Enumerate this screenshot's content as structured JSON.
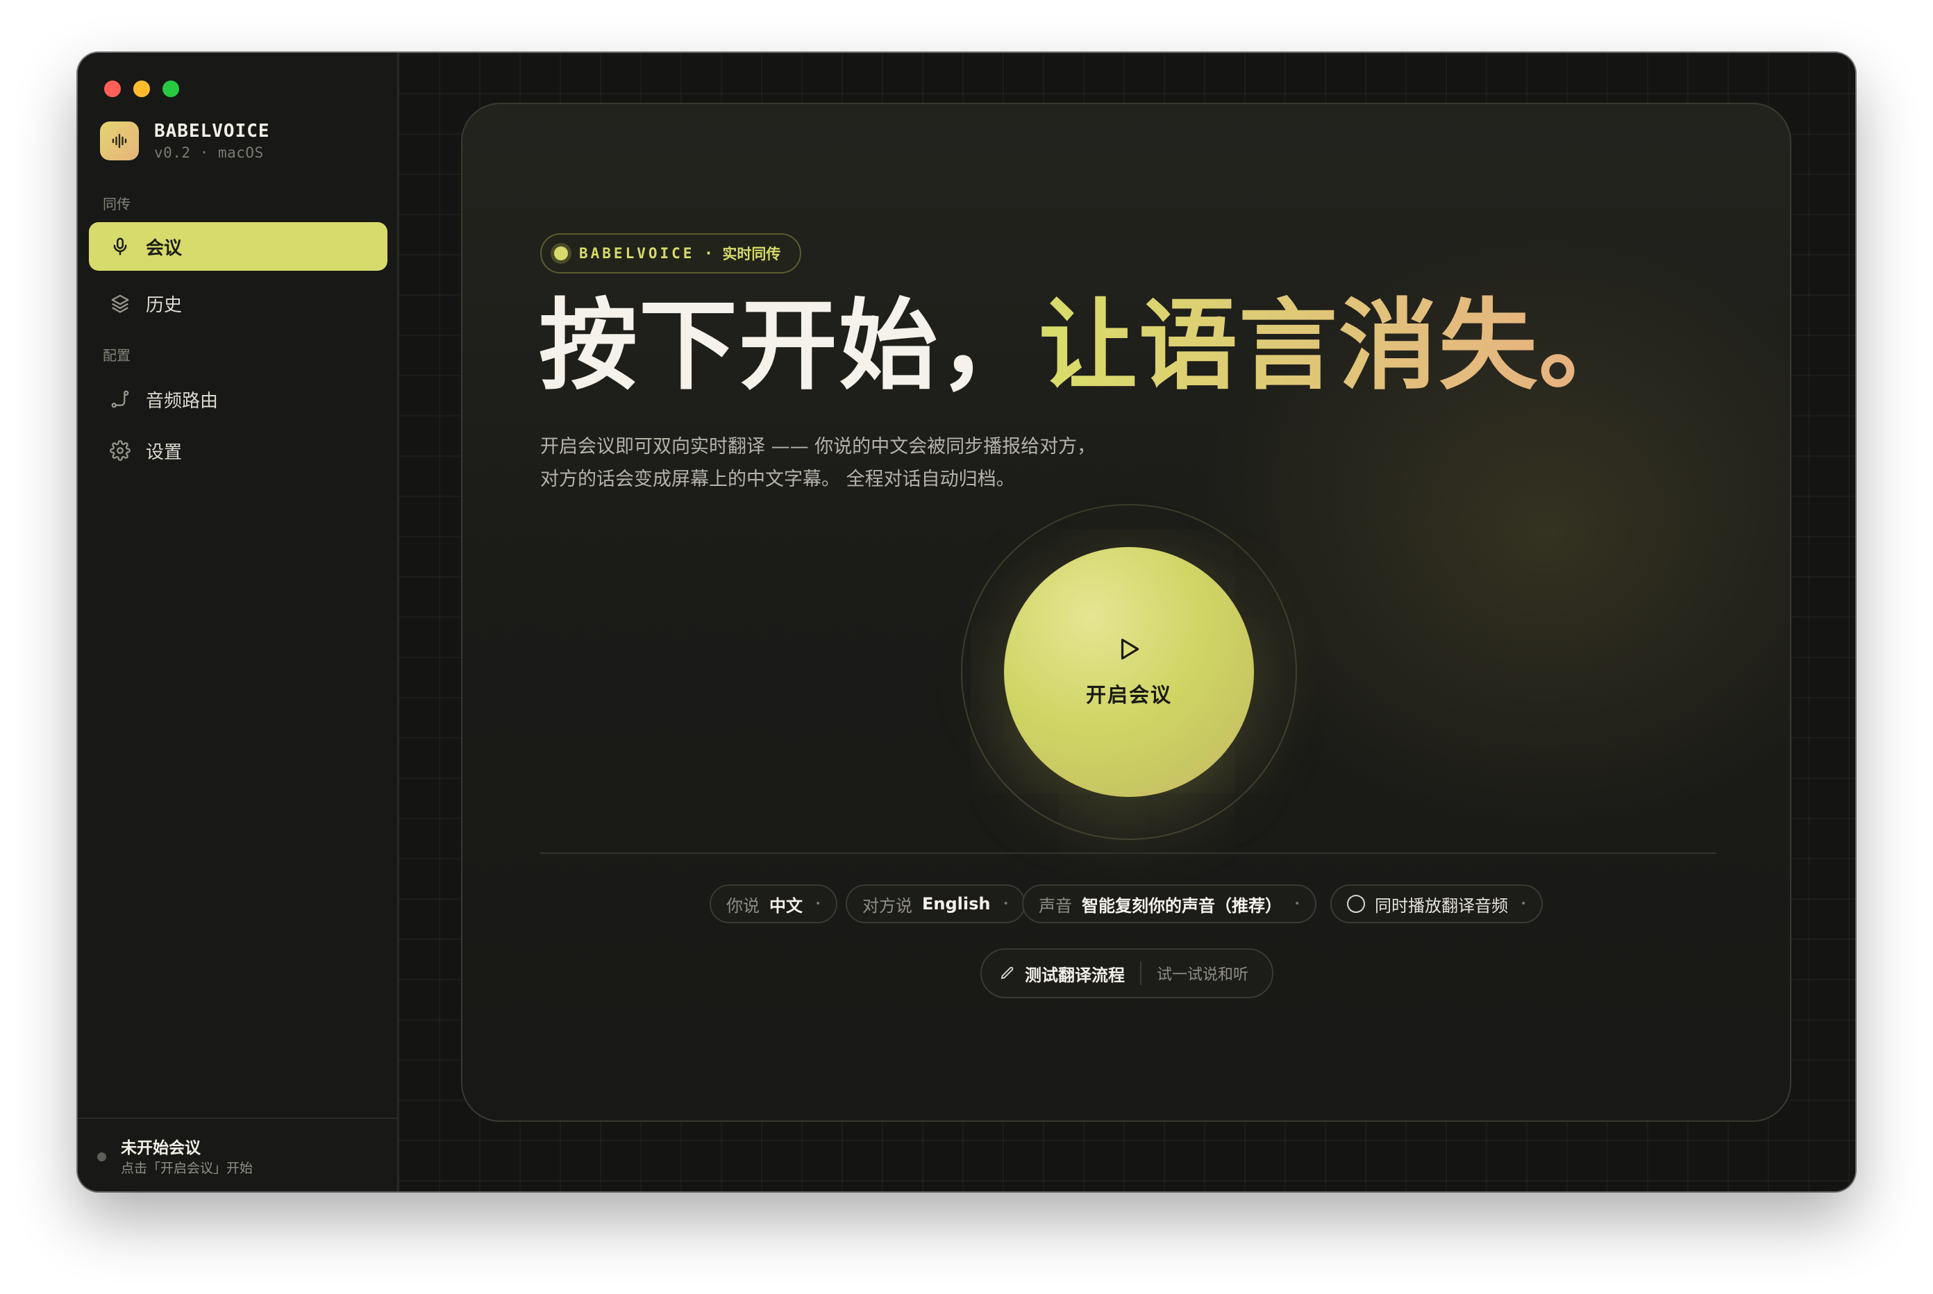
{
  "window": {
    "controls": [
      "close",
      "minimize",
      "zoom"
    ]
  },
  "brand": {
    "name": "BABELVOICE",
    "version": "v0.2 · macOS",
    "logo_icon": "waveform-icon"
  },
  "sidebar": {
    "sections": [
      {
        "label": "同传",
        "items": [
          {
            "label": "会议",
            "icon": "microphone-icon",
            "active": true
          },
          {
            "label": "历史",
            "icon": "layers-icon",
            "active": false
          }
        ]
      },
      {
        "label": "配置",
        "items": [
          {
            "label": "音频路由",
            "icon": "route-icon",
            "active": false
          },
          {
            "label": "设置",
            "icon": "gear-icon",
            "active": false
          }
        ]
      }
    ],
    "footer": {
      "title": "未开始会议",
      "subtitle": "点击「开启会议」开始"
    }
  },
  "hero": {
    "tag_brand": "BABELVOICE",
    "tag_separator": "·",
    "tag_text": "实时同传",
    "headline_main": "按下开始，",
    "headline_accent": "让语言消失。",
    "description_line1": "开启会议即可双向实时翻译 —— 你说的中文会被同步播报给对方，",
    "description_line2": "对方的话会变成屏幕上的中文字幕。 全程对话自动归档。"
  },
  "start_button": {
    "label": "开启会议",
    "icon": "play-icon"
  },
  "options": {
    "you_speak_key": "你说",
    "you_speak_value": "中文",
    "they_speak_key": "对方说",
    "they_speak_value": "English",
    "voice_key": "声音",
    "voice_value": "智能复刻你的声音（推荐）",
    "playback_label": "同时播放翻译音频",
    "playback_enabled": false
  },
  "test_flow": {
    "label": "测试翻译流程",
    "hint": "试一试说和听",
    "icon": "pencil-icon"
  },
  "colors": {
    "accent": "#d6db6b",
    "accent_warm": "#e8ad80",
    "background": "#141412",
    "sidebar": "#181816"
  }
}
